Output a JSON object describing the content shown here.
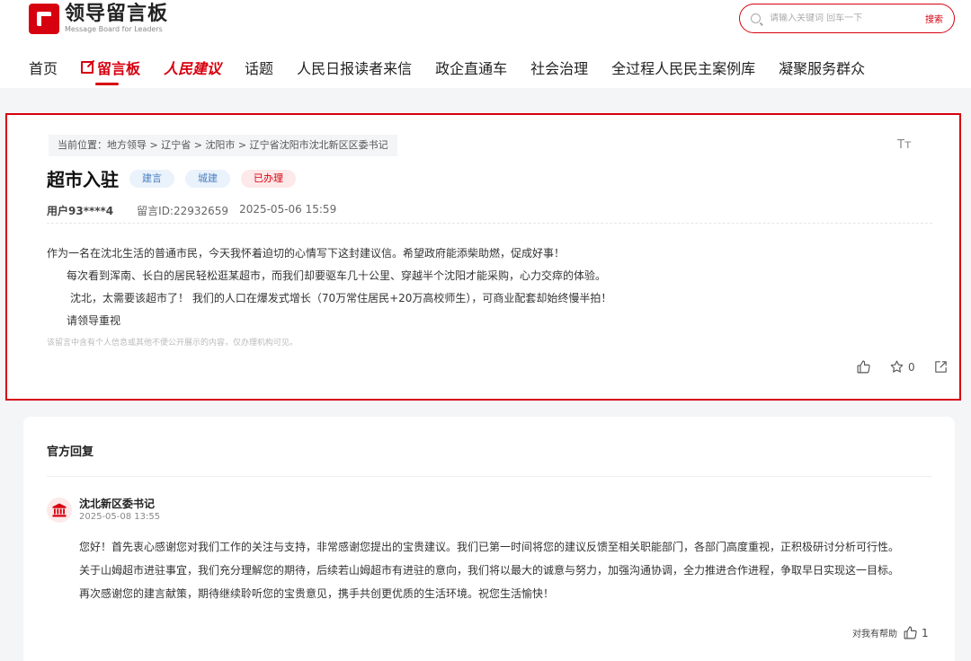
{
  "header": {
    "logo_cn": "领导留言板",
    "logo_en": "Message Board for Leaders",
    "search_placeholder": "请输入关键词 回车一下",
    "search_button": "搜索"
  },
  "nav": {
    "home": "首页",
    "message_board": "留言板",
    "people_suggest": "人民建议",
    "topics": "话题",
    "reader_letters": "人民日报读者来信",
    "gov_enterprise": "政企直通车",
    "social_gov": "社会治理",
    "democracy_cases": "全过程人民民主案例库",
    "serve_masses": "凝聚服务群众"
  },
  "message": {
    "breadcrumb": "当前位置：地方领导 > 辽宁省 > 沈阳市 > 辽宁省沈阳市沈北新区区委书记",
    "font_toggle": "Tт",
    "title": "超市入驻",
    "tags": [
      "建言",
      "城建",
      "已办理"
    ],
    "user": "用户93****4",
    "message_id": "留言ID:22932659",
    "datetime": "2025-05-06 15:59",
    "paragraphs": [
      "作为一名在沈北生活的普通市民，今天我怀着迫切的心情写下这封建议信。希望政府能添柴助燃，促成好事！",
      "每次看到浑南、长白的居民轻松逛某超市，而我们却要驱车几十公里、穿越半个沈阳才能采购，心力交瘁的体验。",
      "沈北，太需要该超市了！ 我们的人口在爆发式增长（70万常住居民+20万高校师生），可商业配套却始终慢半拍！",
      "请领导重视"
    ],
    "notice": "该留言中含有个人信息或其他不便公开展示的内容，仅办理机构可见。",
    "favorite_count": "0"
  },
  "reply": {
    "heading": "官方回复",
    "org_name": "沈北新区委书记",
    "org_date": "2025-05-08 13:55",
    "paragraphs": [
      "您好！首先衷心感谢您对我们工作的关注与支持，非常感谢您提出的宝贵建议。我们已第一时间将您的建议反馈至相关职能部门，各部门高度重视，正积极研讨分析可行性。",
      "关于山姆超市进驻事宜，我们充分理解您的期待，后续若山姆超市有进驻的意向，我们将以最大的诚意与努力，加强沟通协调，全力推进合作进程，争取早日实现这一目标。",
      "再次感谢您的建言献策，期待继续聆听您的宝贵意见，携手共创更优质的生活环境。祝您生活愉快！"
    ],
    "helpful_label": "对我有帮助",
    "helpful_count": "1"
  },
  "colors": {
    "brand_red": "#d7000f",
    "tag_blue": "#4a7fc1"
  }
}
